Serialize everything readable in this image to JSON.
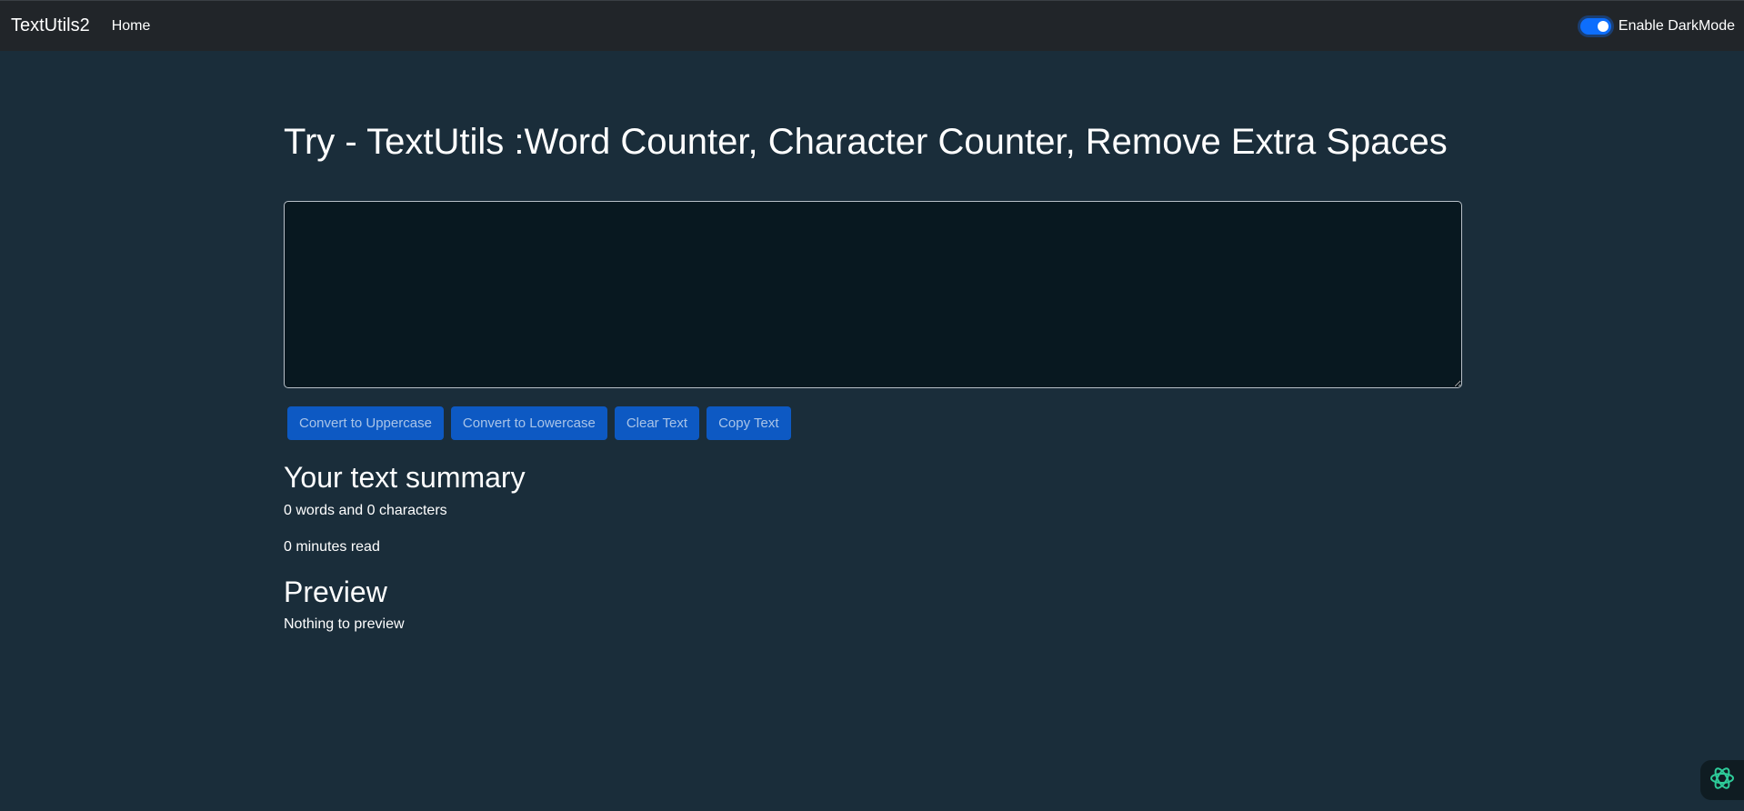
{
  "navbar": {
    "brand": "TextUtils2",
    "links": [
      "Home"
    ],
    "dark_mode_label": "Enable DarkMode",
    "dark_mode_enabled": true
  },
  "main": {
    "title": "Try - TextUtils :Word Counter, Character Counter, Remove Extra Spaces",
    "textarea_value": "",
    "buttons": [
      {
        "label": "Convert to Uppercase"
      },
      {
        "label": "Convert to Lowercase"
      },
      {
        "label": "Clear Text"
      },
      {
        "label": "Copy Text"
      }
    ],
    "summary": {
      "heading": "Your text summary",
      "counts": "0 words and 0 characters",
      "read_time": "0 minutes read"
    },
    "preview": {
      "heading": "Preview",
      "text": "Nothing to preview"
    }
  },
  "icons": {
    "fab": "atom-assistant-icon"
  },
  "colors": {
    "background": "#1a2d3a",
    "navbar": "#212529",
    "textarea": "#081820",
    "button": "#0d59c3",
    "toggle": "#0d6efd",
    "fab_icon": "#2ecc9a"
  }
}
